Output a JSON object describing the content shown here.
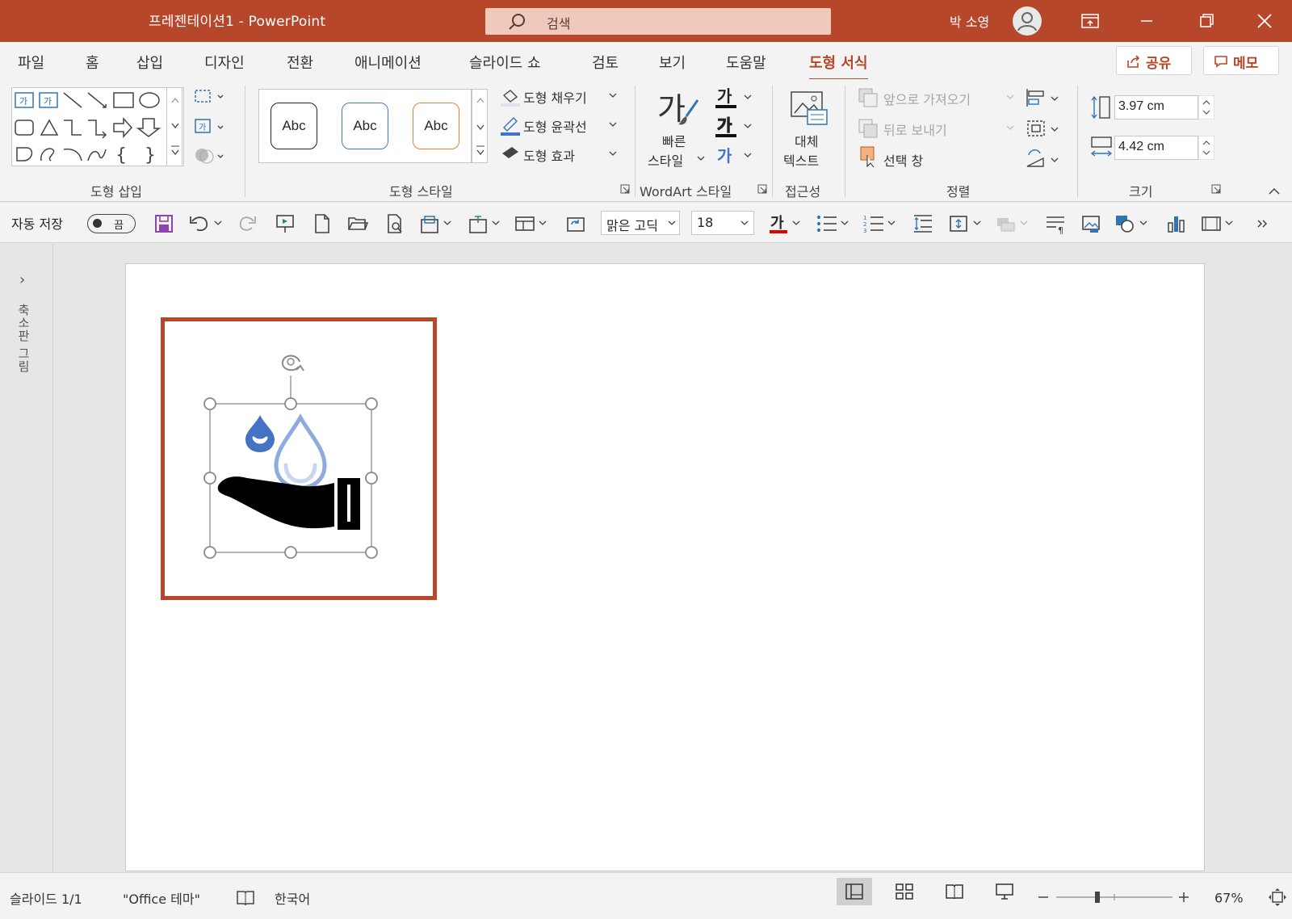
{
  "window": {
    "title": "프레젠테이션1  -  PowerPoint",
    "search_placeholder": "검색",
    "user": "박 소영"
  },
  "tabs": [
    "파일",
    "홈",
    "삽입",
    "디자인",
    "전환",
    "애니메이션",
    "슬라이드 쇼",
    "검토",
    "보기",
    "도움말",
    "도형 서식"
  ],
  "active_tab": "도형 서식",
  "share_button": "공유",
  "memo_button": "메모",
  "ribbon": {
    "insert_shapes": {
      "label": "도형 삽입"
    },
    "shape_styles": {
      "label": "도형 스타일",
      "presets": [
        "Abc",
        "Abc",
        "Abc"
      ],
      "fill": "도형 채우기",
      "outline": "도형 윤곽선",
      "effects": "도형 효과"
    },
    "wordart": {
      "label": "WordArt 스타일",
      "quick_styles_line1": "빠른",
      "quick_styles_line2": "스타일",
      "glyph": "가"
    },
    "accessibility": {
      "label": "접근성",
      "alt_text_line1": "대체",
      "alt_text_line2": "텍스트"
    },
    "arrange": {
      "label": "정렬",
      "bring_forward": "앞으로 가져오기",
      "send_backward": "뒤로 보내기",
      "selection_pane": "선택 창"
    },
    "size": {
      "label": "크기",
      "height": "3.97 cm",
      "width": "4.42 cm"
    }
  },
  "qat": {
    "autosave_label": "자동 저장",
    "autosave_state": "끔",
    "font_name": "맑은 고딕",
    "font_size": "18",
    "text_glyph": "가"
  },
  "left_rail": {
    "label": "축소판 그림"
  },
  "status": {
    "slide": "슬라이드 1/1",
    "theme": "\"Office 테마\"",
    "language": "한국어",
    "zoom": "67%",
    "zoom_level": 0.67
  },
  "colors": {
    "accent": "#b7472a",
    "drop_dark": "#4472c4",
    "drop_light": "#8faadc"
  }
}
